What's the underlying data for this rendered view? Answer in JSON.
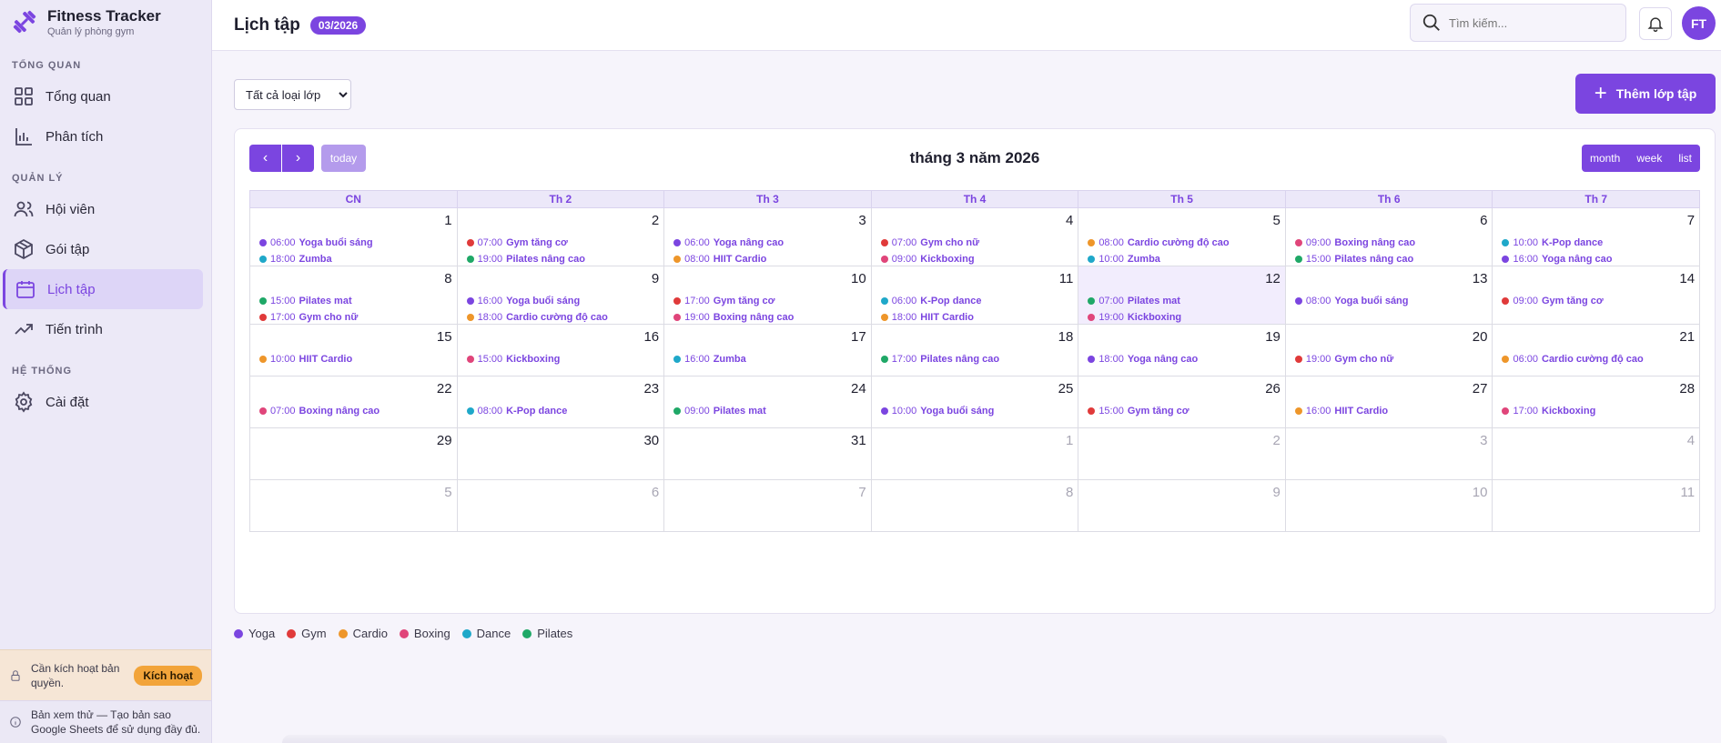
{
  "brand": {
    "title": "Fitness Tracker",
    "subtitle": "Quản lý phòng gym"
  },
  "sidebar": {
    "sections": [
      {
        "title": "TỔNG QUAN",
        "items": [
          {
            "label": "Tổng quan",
            "icon": "dashboard-icon"
          },
          {
            "label": "Phân tích",
            "icon": "chart-icon"
          }
        ]
      },
      {
        "title": "QUẢN LÝ",
        "items": [
          {
            "label": "Hội viên",
            "icon": "users-icon"
          },
          {
            "label": "Gói tập",
            "icon": "package-icon"
          },
          {
            "label": "Lịch tập",
            "icon": "calendar-icon",
            "active": true
          },
          {
            "label": "Tiến trình",
            "icon": "trend-icon"
          }
        ]
      },
      {
        "title": "HỆ THỐNG",
        "items": [
          {
            "label": "Cài đặt",
            "icon": "gear-icon"
          }
        ]
      }
    ],
    "license_text": "Cần kích hoạt bản quyền.",
    "license_button": "Kích hoạt",
    "trial_text": "Bản xem thử — Tạo bản sao Google Sheets để sử dụng đầy đủ."
  },
  "header": {
    "title": "Lịch tập",
    "period": "03/2026",
    "search_placeholder": "Tìm kiếm...",
    "avatar": "FT"
  },
  "toolbar": {
    "filter_value": "Tất cả loại lớp",
    "add_button": "Thêm lớp tập"
  },
  "calendar": {
    "title": "tháng 3 năm 2026",
    "today_label": "today",
    "views": [
      "month",
      "week",
      "list"
    ],
    "weekdays": [
      "CN",
      "Th 2",
      "Th 3",
      "Th 4",
      "Th 5",
      "Th 6",
      "Th 7"
    ],
    "today_day": 12,
    "weeks": [
      [
        {
          "d": "1",
          "ev": [
            [
              "06:00",
              "Yoga buổi sáng",
              "Yoga"
            ],
            [
              "18:00",
              "Zumba",
              "Dance"
            ]
          ]
        },
        {
          "d": "2",
          "ev": [
            [
              "07:00",
              "Gym tăng cơ",
              "Gym"
            ],
            [
              "19:00",
              "Pilates nâng cao",
              "Pilates"
            ]
          ]
        },
        {
          "d": "3",
          "ev": [
            [
              "06:00",
              "Yoga nâng cao",
              "Yoga"
            ],
            [
              "08:00",
              "HIIT Cardio",
              "Cardio"
            ]
          ]
        },
        {
          "d": "4",
          "ev": [
            [
              "07:00",
              "Gym cho nữ",
              "Gym"
            ],
            [
              "09:00",
              "Kickboxing",
              "Boxing"
            ]
          ]
        },
        {
          "d": "5",
          "ev": [
            [
              "08:00",
              "Cardio cường độ cao",
              "Cardio"
            ],
            [
              "10:00",
              "Zumba",
              "Dance"
            ]
          ]
        },
        {
          "d": "6",
          "ev": [
            [
              "09:00",
              "Boxing nâng cao",
              "Boxing"
            ],
            [
              "15:00",
              "Pilates nâng cao",
              "Pilates"
            ]
          ]
        },
        {
          "d": "7",
          "ev": [
            [
              "10:00",
              "K-Pop dance",
              "Dance"
            ],
            [
              "16:00",
              "Yoga nâng cao",
              "Yoga"
            ]
          ]
        }
      ],
      [
        {
          "d": "8",
          "ev": [
            [
              "15:00",
              "Pilates mat",
              "Pilates"
            ],
            [
              "17:00",
              "Gym cho nữ",
              "Gym"
            ]
          ]
        },
        {
          "d": "9",
          "ev": [
            [
              "16:00",
              "Yoga buổi sáng",
              "Yoga"
            ],
            [
              "18:00",
              "Cardio cường độ cao",
              "Cardio"
            ]
          ]
        },
        {
          "d": "10",
          "ev": [
            [
              "17:00",
              "Gym tăng cơ",
              "Gym"
            ],
            [
              "19:00",
              "Boxing nâng cao",
              "Boxing"
            ]
          ]
        },
        {
          "d": "11",
          "ev": [
            [
              "06:00",
              "K-Pop dance",
              "Dance"
            ],
            [
              "18:00",
              "HIIT Cardio",
              "Cardio"
            ]
          ]
        },
        {
          "d": "12",
          "ev": [
            [
              "07:00",
              "Pilates mat",
              "Pilates"
            ],
            [
              "19:00",
              "Kickboxing",
              "Boxing"
            ]
          ]
        },
        {
          "d": "13",
          "ev": [
            [
              "08:00",
              "Yoga buổi sáng",
              "Yoga"
            ]
          ]
        },
        {
          "d": "14",
          "ev": [
            [
              "09:00",
              "Gym tăng cơ",
              "Gym"
            ]
          ]
        }
      ],
      [
        {
          "d": "15",
          "ev": [
            [
              "10:00",
              "HIIT Cardio",
              "Cardio"
            ]
          ]
        },
        {
          "d": "16",
          "ev": [
            [
              "15:00",
              "Kickboxing",
              "Boxing"
            ]
          ]
        },
        {
          "d": "17",
          "ev": [
            [
              "16:00",
              "Zumba",
              "Dance"
            ]
          ]
        },
        {
          "d": "18",
          "ev": [
            [
              "17:00",
              "Pilates nâng cao",
              "Pilates"
            ]
          ]
        },
        {
          "d": "19",
          "ev": [
            [
              "18:00",
              "Yoga nâng cao",
              "Yoga"
            ]
          ]
        },
        {
          "d": "20",
          "ev": [
            [
              "19:00",
              "Gym cho nữ",
              "Gym"
            ]
          ]
        },
        {
          "d": "21",
          "ev": [
            [
              "06:00",
              "Cardio cường độ cao",
              "Cardio"
            ]
          ]
        }
      ],
      [
        {
          "d": "22",
          "ev": [
            [
              "07:00",
              "Boxing nâng cao",
              "Boxing"
            ]
          ]
        },
        {
          "d": "23",
          "ev": [
            [
              "08:00",
              "K-Pop dance",
              "Dance"
            ]
          ]
        },
        {
          "d": "24",
          "ev": [
            [
              "09:00",
              "Pilates mat",
              "Pilates"
            ]
          ]
        },
        {
          "d": "25",
          "ev": [
            [
              "10:00",
              "Yoga buổi sáng",
              "Yoga"
            ]
          ]
        },
        {
          "d": "26",
          "ev": [
            [
              "15:00",
              "Gym tăng cơ",
              "Gym"
            ]
          ]
        },
        {
          "d": "27",
          "ev": [
            [
              "16:00",
              "HIIT Cardio",
              "Cardio"
            ]
          ]
        },
        {
          "d": "28",
          "ev": [
            [
              "17:00",
              "Kickboxing",
              "Boxing"
            ]
          ]
        }
      ],
      [
        {
          "d": "29",
          "ev": []
        },
        {
          "d": "30",
          "ev": []
        },
        {
          "d": "31",
          "ev": []
        },
        {
          "d": "1",
          "other": true,
          "ev": []
        },
        {
          "d": "2",
          "other": true,
          "ev": []
        },
        {
          "d": "3",
          "other": true,
          "ev": []
        },
        {
          "d": "4",
          "other": true,
          "ev": []
        }
      ],
      [
        {
          "d": "5",
          "other": true,
          "ev": []
        },
        {
          "d": "6",
          "other": true,
          "ev": []
        },
        {
          "d": "7",
          "other": true,
          "ev": []
        },
        {
          "d": "8",
          "other": true,
          "ev": []
        },
        {
          "d": "9",
          "other": true,
          "ev": []
        },
        {
          "d": "10",
          "other": true,
          "ev": []
        },
        {
          "d": "11",
          "other": true,
          "ev": []
        }
      ]
    ]
  },
  "legend": [
    {
      "label": "Yoga",
      "color": "#7b45e0"
    },
    {
      "label": "Gym",
      "color": "#e03a3a"
    },
    {
      "label": "Cardio",
      "color": "#ee962a"
    },
    {
      "label": "Boxing",
      "color": "#e0457a"
    },
    {
      "label": "Dance",
      "color": "#1fa8c9"
    },
    {
      "label": "Pilates",
      "color": "#1fa867"
    }
  ],
  "colors": {
    "accent": "#7b45e0"
  }
}
